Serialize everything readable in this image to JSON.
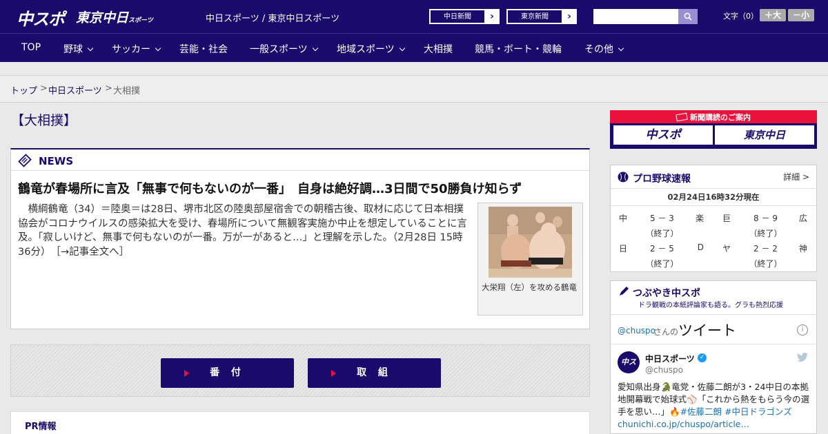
{
  "header": {
    "logo_chuspo": "中スポ",
    "logo_tokyo": "東京中日",
    "logo_tokyo_small": "スポーツ",
    "site_title": "中日スポーツ / 東京中日スポーツ",
    "paper_links": [
      {
        "label": "中日新聞"
      },
      {
        "label": "東京新聞"
      }
    ],
    "search": {
      "value": ""
    },
    "fontsize_label": "文字（0）",
    "fontsize_up": "＋大",
    "fontsize_down": "－小"
  },
  "nav": {
    "items": [
      {
        "label": "TOP",
        "dropdown": false
      },
      {
        "label": "野球",
        "dropdown": true
      },
      {
        "label": "サッカー",
        "dropdown": true
      },
      {
        "label": "芸能・社会",
        "dropdown": false
      },
      {
        "label": "一般スポーツ",
        "dropdown": true
      },
      {
        "label": "地域スポーツ",
        "dropdown": true
      },
      {
        "label": "大相撲",
        "dropdown": false
      },
      {
        "label": "競馬・ボート・競輪",
        "dropdown": false
      },
      {
        "label": "その他",
        "dropdown": true
      }
    ]
  },
  "breadcrumb": {
    "items": [
      "トップ",
      "中日スポーツ",
      "大相撲"
    ],
    "separator": ">"
  },
  "page": {
    "title": "【大相撲】"
  },
  "news": {
    "section_label": "NEWS",
    "headline": "鶴竜が春場所に言及「無事で何もないのが一番」　自身は絶好調…3日間で50勝負け知らず",
    "lede": "横綱鶴竜（34）＝陸奥＝は28日、堺市北区の陸奥部屋宿舎での朝稽古後、取材に応じて日本相撲協会がコロナウイルスの感染拡大を受け、春場所について無観客実施か中止を想定していることに言及。「寂しいけど、無事で何もないのが一番。万が一があると…」と理解を示した。（2月28日 15時36分）",
    "more_link": "［→記事全文へ］",
    "photo_caption": "大栄翔（左）を攻める鶴竜"
  },
  "buttons": {
    "banzuke": "番 付",
    "torikumi": "取 組"
  },
  "pr": {
    "label": "PR情報"
  },
  "sidebar": {
    "subscribe": {
      "title": "新聞購読のご案内",
      "logos": [
        "中スポ",
        "東京中日"
      ]
    },
    "baseball": {
      "title": "プロ野球速報",
      "detail": "詳細 >",
      "as_of": "02月24日16時32分現在",
      "games": [
        {
          "home": "中",
          "score": "5 － 3",
          "away": "楽",
          "status": "（終了）"
        },
        {
          "home": "日",
          "score": "2 － 5",
          "away": "D",
          "status": "（終了）"
        },
        {
          "home": "巨",
          "score": "8 － 9",
          "away": "広",
          "status": "（終了）"
        },
        {
          "home": "ヤ",
          "score": "2 － 2",
          "away": "神",
          "status": "（終了）"
        }
      ]
    },
    "twitter": {
      "title": "つぶやき中スポ",
      "subtitle": "ドラ観戦の本紙評論家も語る。グラも熱烈応援",
      "handle_link": "@chuspo",
      "handle_suffix": "さんの",
      "tweets_label": "ツイート",
      "avatar_text": "中スポ",
      "user_name": "中日スポーツ",
      "user_handle": "@chuspo",
      "tweet_text_1": "愛知県出身🐊竜党・佐藤二朗が3・24中日の本拠地開幕戦で始球式⚾「これから熱をもらう今の選手を思い…」🔥",
      "tweet_tags": "#佐藤二朗 #中日ドラゴンズ",
      "tweet_link": "chunichi.co.jp/chuspo/article…"
    }
  }
}
